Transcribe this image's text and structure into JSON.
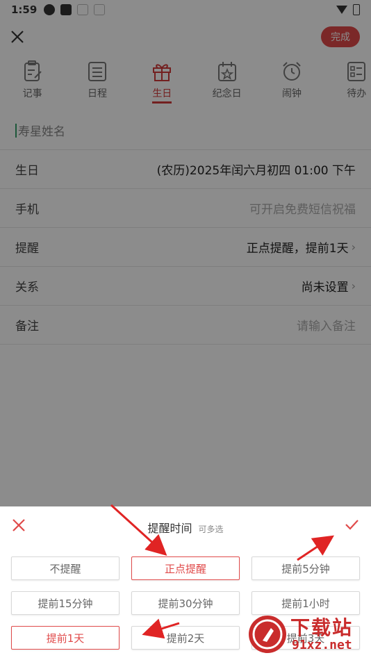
{
  "status_bar": {
    "time": "1:59"
  },
  "top_bar": {
    "done_label": "完成"
  },
  "tabs": [
    {
      "label": "记事"
    },
    {
      "label": "日程"
    },
    {
      "label": "生日"
    },
    {
      "label": "纪念日"
    },
    {
      "label": "闹钟"
    },
    {
      "label": "待办"
    }
  ],
  "form": {
    "name_placeholder": "寿星姓名",
    "birthday_label": "生日",
    "birthday_value": "(农历)2025年闰六月初四 01:00 下午",
    "phone_label": "手机",
    "phone_placeholder": "可开启免费短信祝福",
    "reminder_label": "提醒",
    "reminder_value": "正点提醒，提前1天",
    "relation_label": "关系",
    "relation_value": "尚未设置",
    "note_label": "备注",
    "note_placeholder": "请输入备注"
  },
  "sheet": {
    "title": "提醒时间",
    "subtitle": "可多选",
    "options": [
      {
        "label": "不提醒",
        "selected": false
      },
      {
        "label": "正点提醒",
        "selected": true
      },
      {
        "label": "提前5分钟",
        "selected": false
      },
      {
        "label": "提前15分钟",
        "selected": false
      },
      {
        "label": "提前30分钟",
        "selected": false
      },
      {
        "label": "提前1小时",
        "selected": false
      },
      {
        "label": "提前1天",
        "selected": true
      },
      {
        "label": "提前2天",
        "selected": false
      },
      {
        "label": "提前3天",
        "selected": false
      }
    ]
  },
  "watermark": {
    "title": "下载站",
    "site": "91xz.net"
  },
  "colors": {
    "accent": "#e04a4a",
    "arrow": "#e02424"
  }
}
